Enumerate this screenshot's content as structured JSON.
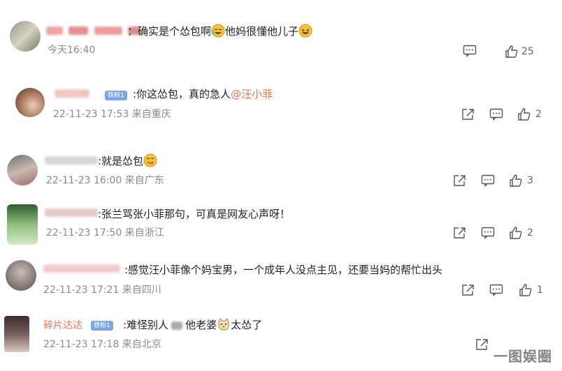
{
  "comments": [
    {
      "name": "",
      "badge": "",
      "text_before": "：确实是个怂包啊",
      "text_middle": "他妈很懂他儿子",
      "mention": "",
      "time": "今天16:40",
      "location": "",
      "likes": "25",
      "emoji1": "crying-laughing-emoji",
      "emoji2": "laughing-emoji"
    },
    {
      "name": "",
      "badge": "铁粉1",
      "text_before": ":你这怂包，真的急人",
      "mention": "@汪小菲",
      "time": "22-11-23 17:53",
      "location": "来自重庆",
      "likes": "2"
    },
    {
      "name": "",
      "badge": "",
      "text_before": ":就是怂包",
      "mention": "",
      "time": "22-11-23 16:00",
      "location": "来自广东",
      "likes": "3",
      "emoji1": "yum-emoji"
    },
    {
      "name": "",
      "badge": "",
      "text_before": ":张兰骂张小菲那句，可真是网友心声呀！",
      "mention": "",
      "time": "22-11-23 17:50",
      "location": "来自浙江",
      "likes": "2"
    },
    {
      "name": "",
      "badge": "",
      "text_before": ":感觉汪小菲像个妈宝男，一个成年人没点主见，还要当妈的帮忙出头",
      "mention": "",
      "time": "22-11-23 17:21",
      "location": "来自四川",
      "likes": "1"
    },
    {
      "name": "碎片达达",
      "badge": "铁粉1",
      "text_before": ":难怪别人",
      "text_middle": "他老婆",
      "text_after": "太怂了",
      "mention": "",
      "time": "22-11-23 17:18",
      "location": "来自北京",
      "likes": "",
      "emoji1": "cat-emoji"
    }
  ],
  "watermark": "一图娱圈",
  "colors": {
    "mention": "#eb7350",
    "name_link": "#eb7350",
    "meta": "#8a8a8a",
    "badge": "#7aa6e6"
  }
}
